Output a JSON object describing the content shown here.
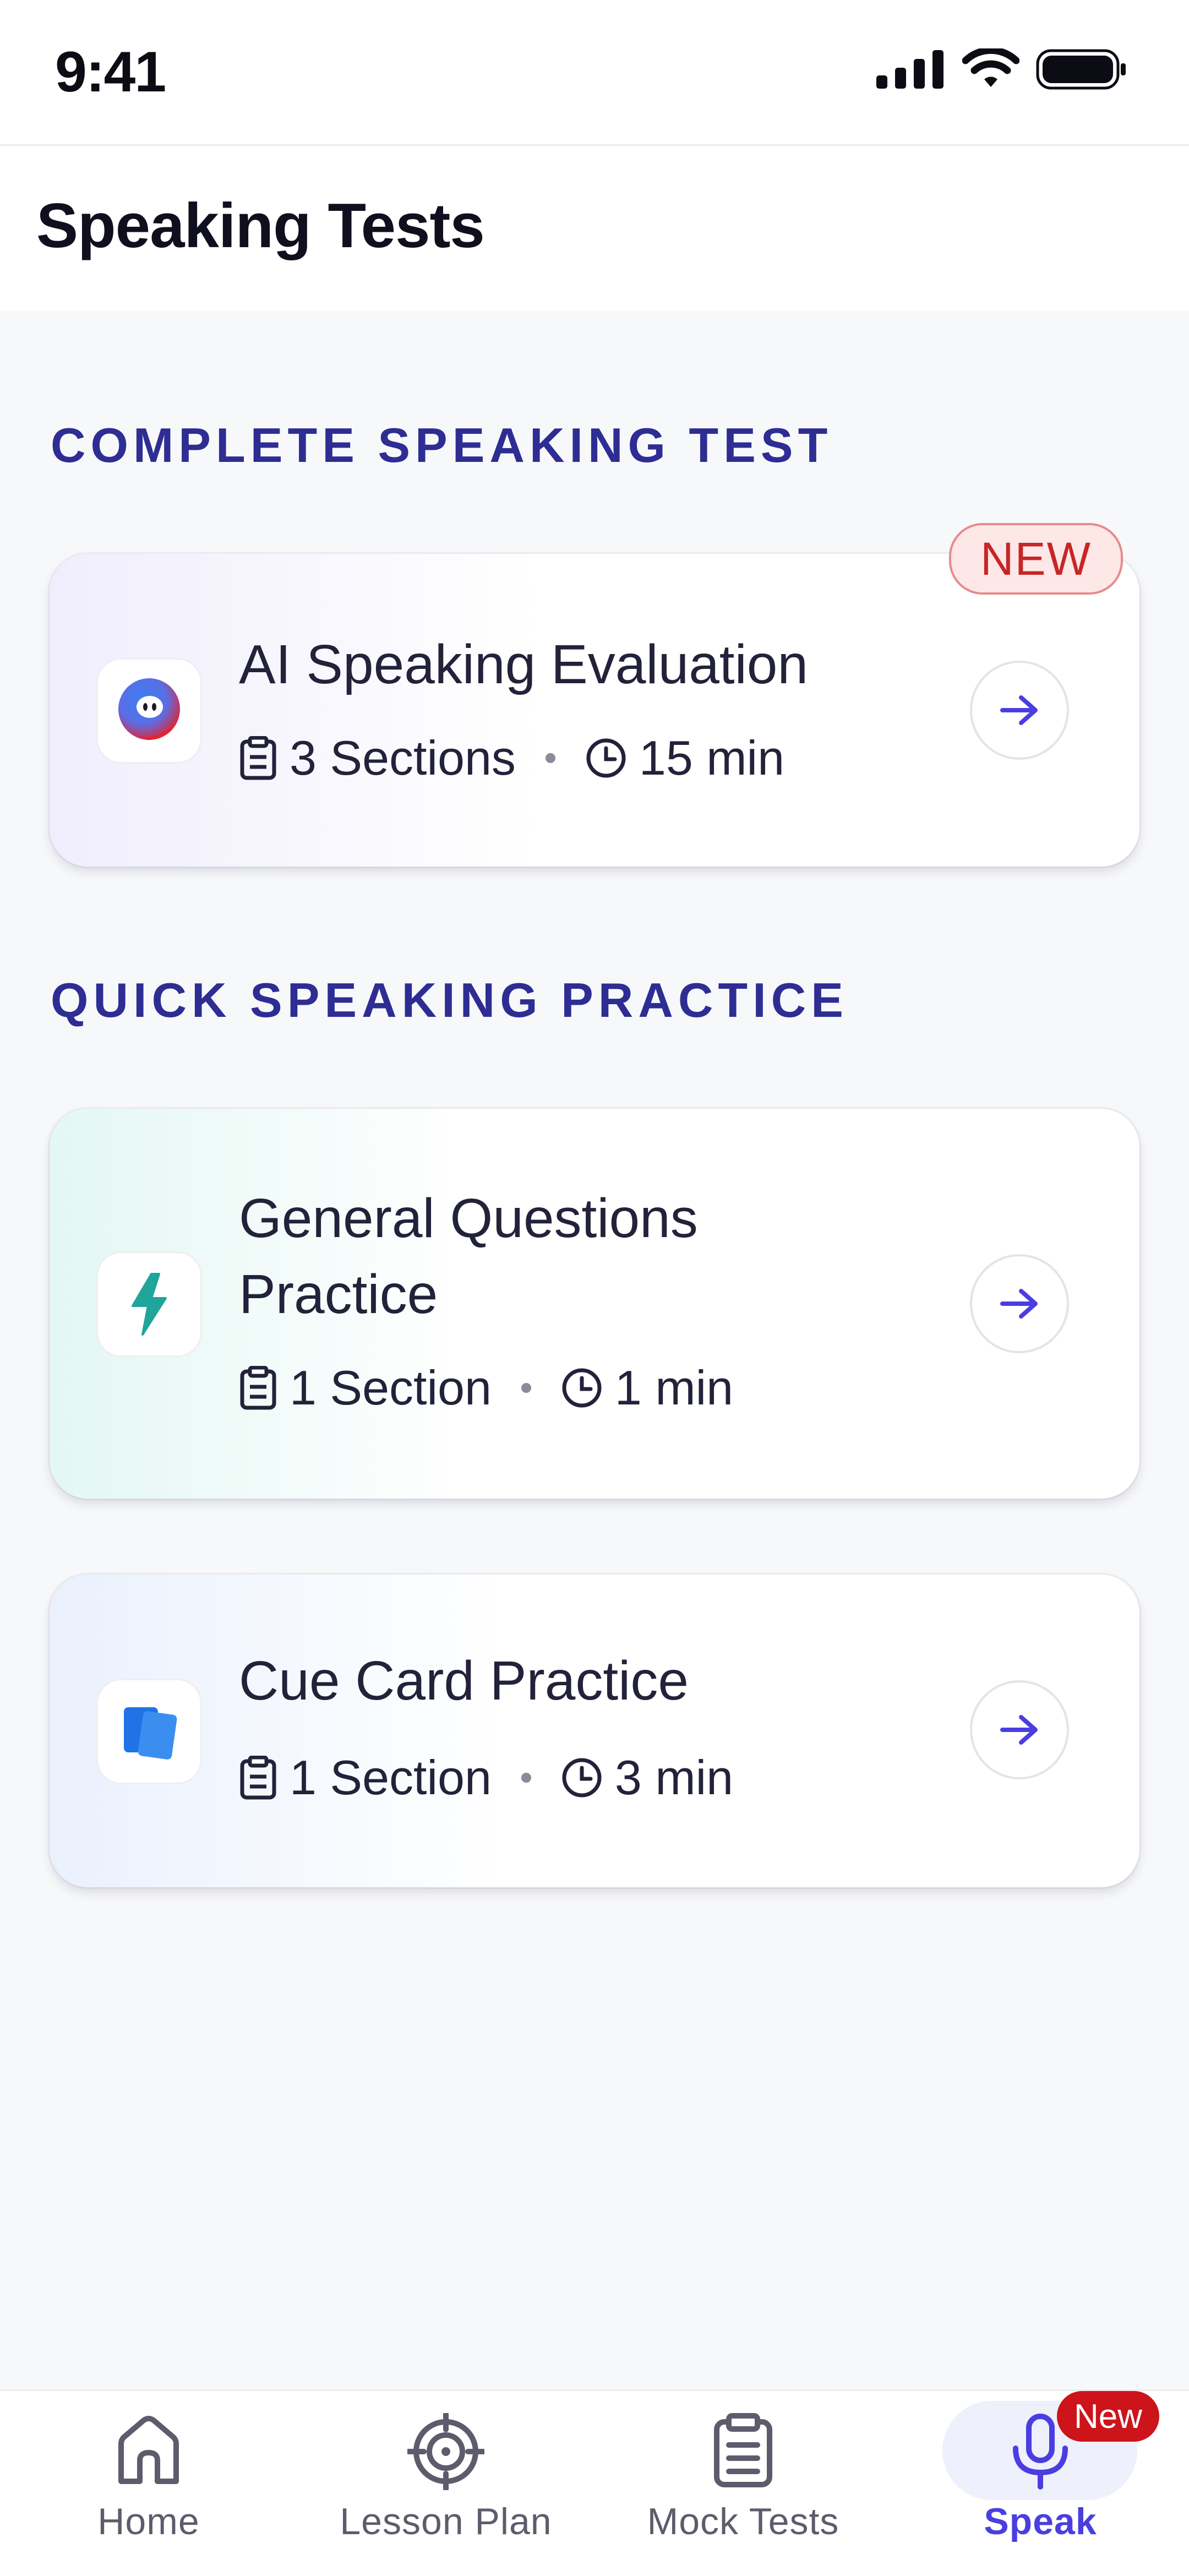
{
  "status_bar": {
    "time": "9:41"
  },
  "header": {
    "title": "Speaking Tests"
  },
  "sections": [
    {
      "label": "COMPLETE SPEAKING TEST"
    },
    {
      "label": "QUICK SPEAKING PRACTICE"
    }
  ],
  "cards": [
    {
      "title": "AI Speaking Evaluation",
      "sections": "3 Sections",
      "duration": "15 min",
      "badge": "NEW",
      "icon": "ai-mascot-icon"
    },
    {
      "title_line1": "General Questions",
      "title_line2": "Practice",
      "sections": "1 Section",
      "duration": "1 min",
      "icon": "lightning-icon"
    },
    {
      "title": "Cue Card Practice",
      "sections": "1 Section",
      "duration": "3 min",
      "icon": "cards-icon"
    }
  ],
  "tab_bar": {
    "items": [
      {
        "label": "Home",
        "icon": "home-icon"
      },
      {
        "label": "Lesson Plan",
        "icon": "target-icon"
      },
      {
        "label": "Mock Tests",
        "icon": "clipboard-icon"
      },
      {
        "label": "Speak",
        "icon": "microphone-icon",
        "active": true,
        "badge": "New"
      }
    ]
  },
  "colors": {
    "accent": "#4a3ee0",
    "section_label": "#2e2d93",
    "badge_red": "#cc141a",
    "lightning": "#1fa59a",
    "cards_blue": "#1f73e6"
  }
}
